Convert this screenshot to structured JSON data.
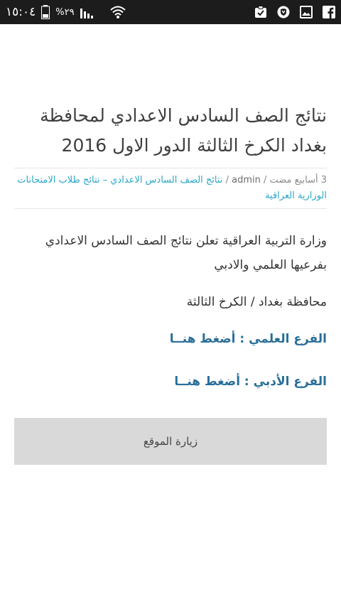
{
  "status_bar": {
    "time": "١٥:٠٤",
    "battery_percent": "%٢٩",
    "icons": [
      "battery-icon",
      "signal-icon",
      "wifi-icon",
      "clipboard-check-icon",
      "shield-icon",
      "image-icon",
      "facebook-icon"
    ]
  },
  "post": {
    "title": "نتائج الصف السادس الاعدادي لمحافظة بغداد الكرخ الثالثة الدور الاول 2016",
    "meta": {
      "time_ago": "3 أسابيع مضت",
      "separator": "/",
      "author": "admin",
      "category": "نتائج الصف السادس الاعدادي – نتائج طلاب الامتحانات الوزارية العراقية"
    },
    "paragraph": "وزارة التربية العراقية تعلن نتائج الصف السادس الاعدادي بفرعيها العلمي والادبي",
    "province_line": "محافظة بغداد / الكرخ الثالثة",
    "scientific_link": "الفرع العلمي : أضغط هنــا",
    "literary_link": "الفرع الأدبي : أضغط هنــا"
  },
  "visit_button": {
    "label": "زيارة الموقع"
  }
}
